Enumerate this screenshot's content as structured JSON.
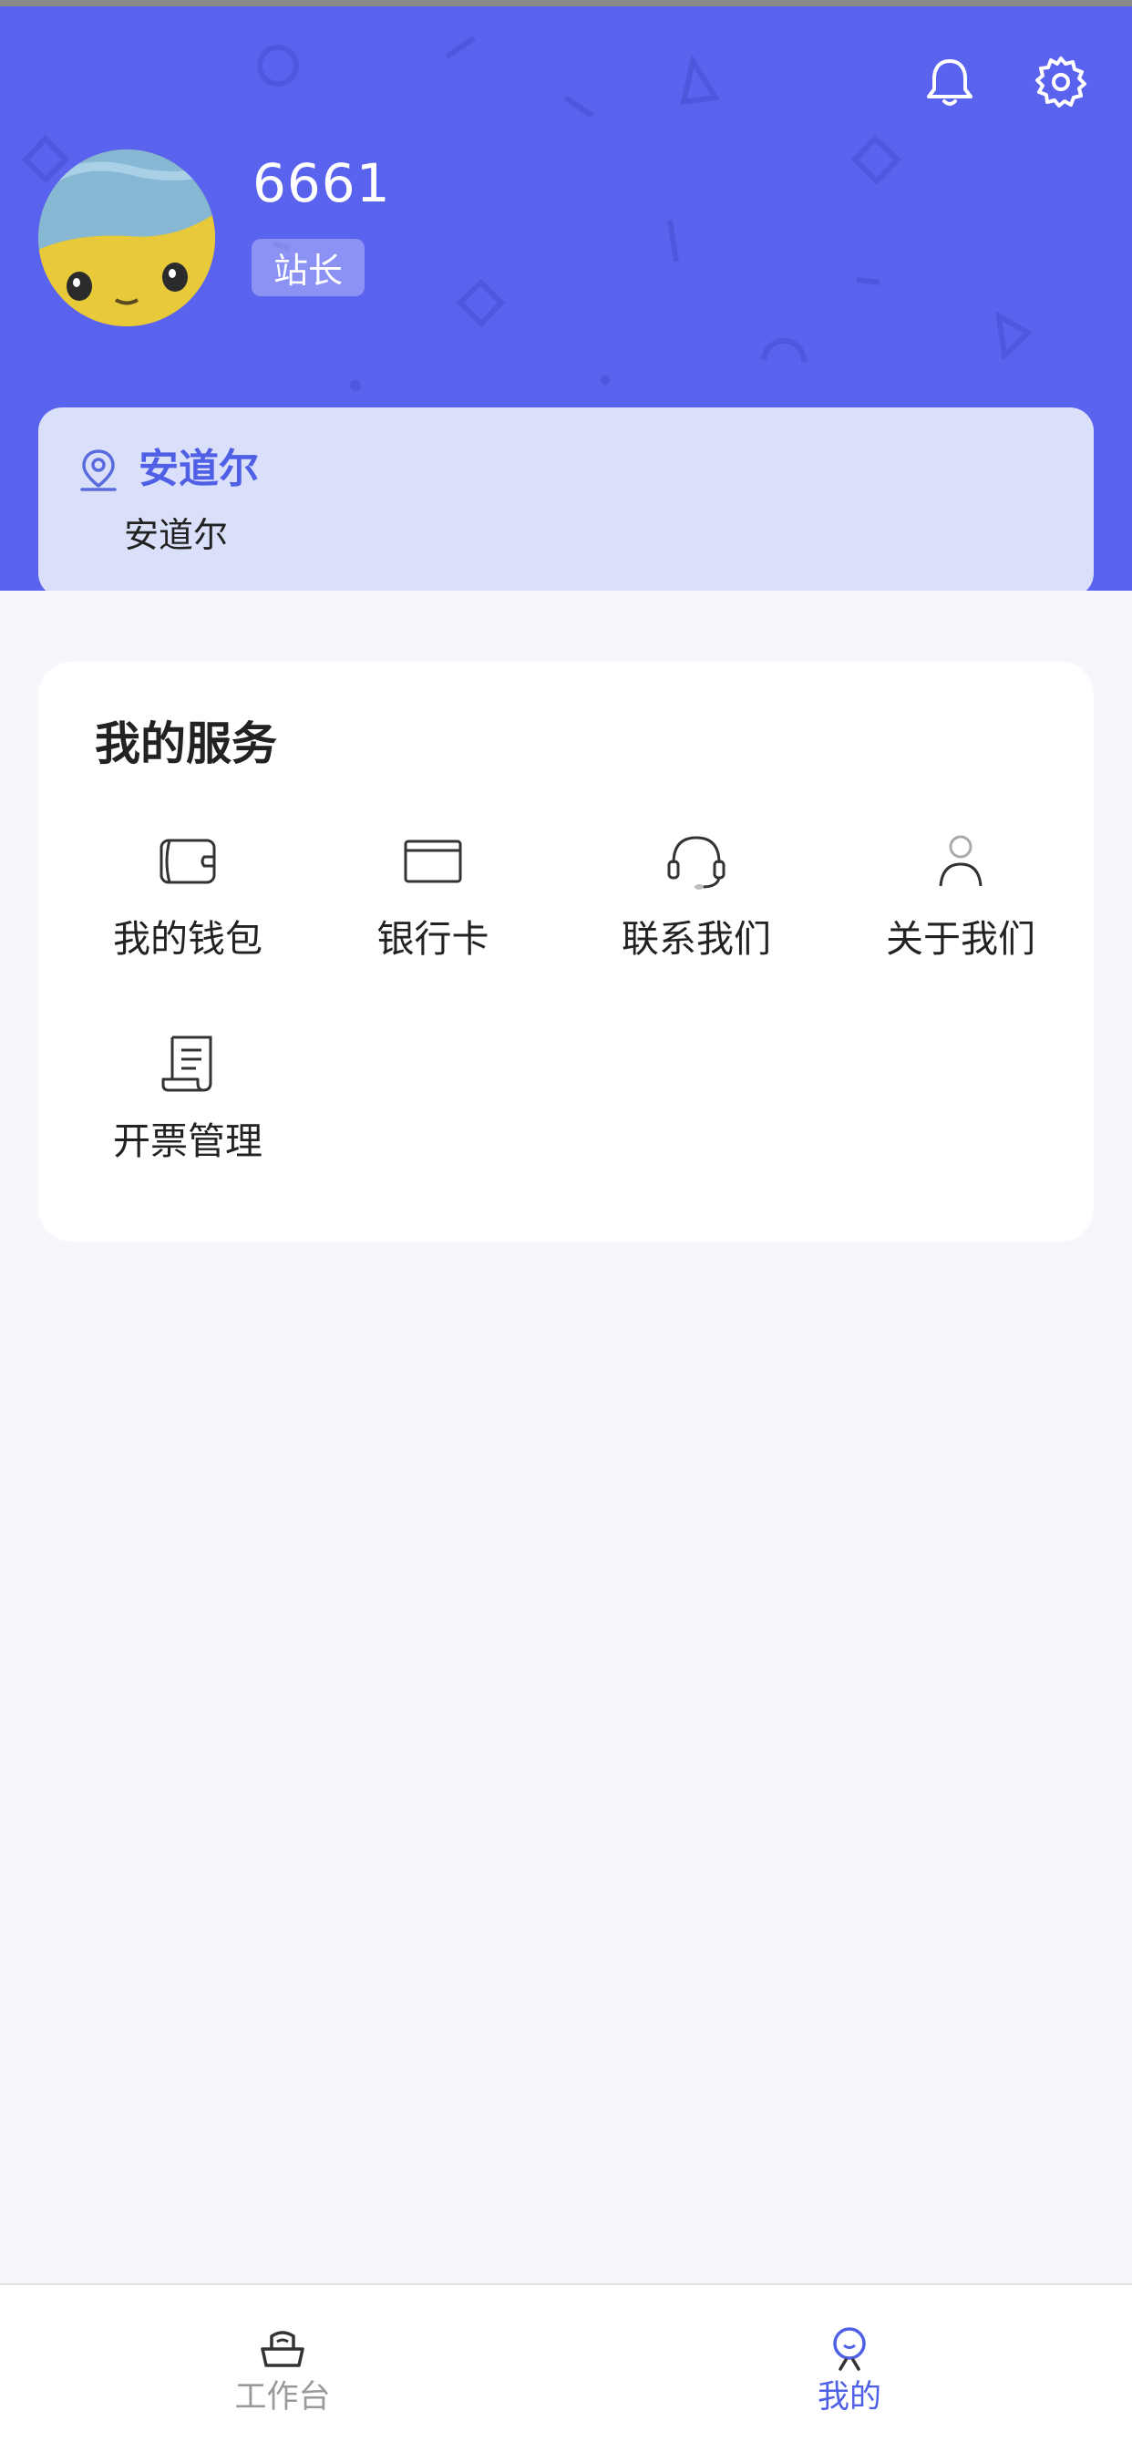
{
  "colors": {
    "header_bg": "#5a63ee",
    "accent": "#5060e6",
    "station_card_bg": "#dbe0fa",
    "page_bg": "#f5f7fd",
    "inactive_tab": "#9a9a9a"
  },
  "header": {
    "bell_icon": "bell-icon",
    "settings_icon": "gear-icon",
    "user": {
      "name": "6661",
      "role": "站长",
      "avatar": "avatar-image"
    }
  },
  "station": {
    "icon": "location-pin-icon",
    "name": "安道尔",
    "subtitle": "安道尔"
  },
  "services": {
    "title": "我的服务",
    "items": [
      {
        "label": "我的钱包",
        "icon": "wallet-icon"
      },
      {
        "label": "银行卡",
        "icon": "bank-card-icon"
      },
      {
        "label": "联系我们",
        "icon": "headset-icon"
      },
      {
        "label": "关于我们",
        "icon": "person-icon"
      },
      {
        "label": "开票管理",
        "icon": "invoice-icon"
      }
    ]
  },
  "tabbar": {
    "tabs": [
      {
        "label": "工作台",
        "icon": "workbench-icon",
        "active": false
      },
      {
        "label": "我的",
        "icon": "profile-icon",
        "active": true
      }
    ]
  }
}
